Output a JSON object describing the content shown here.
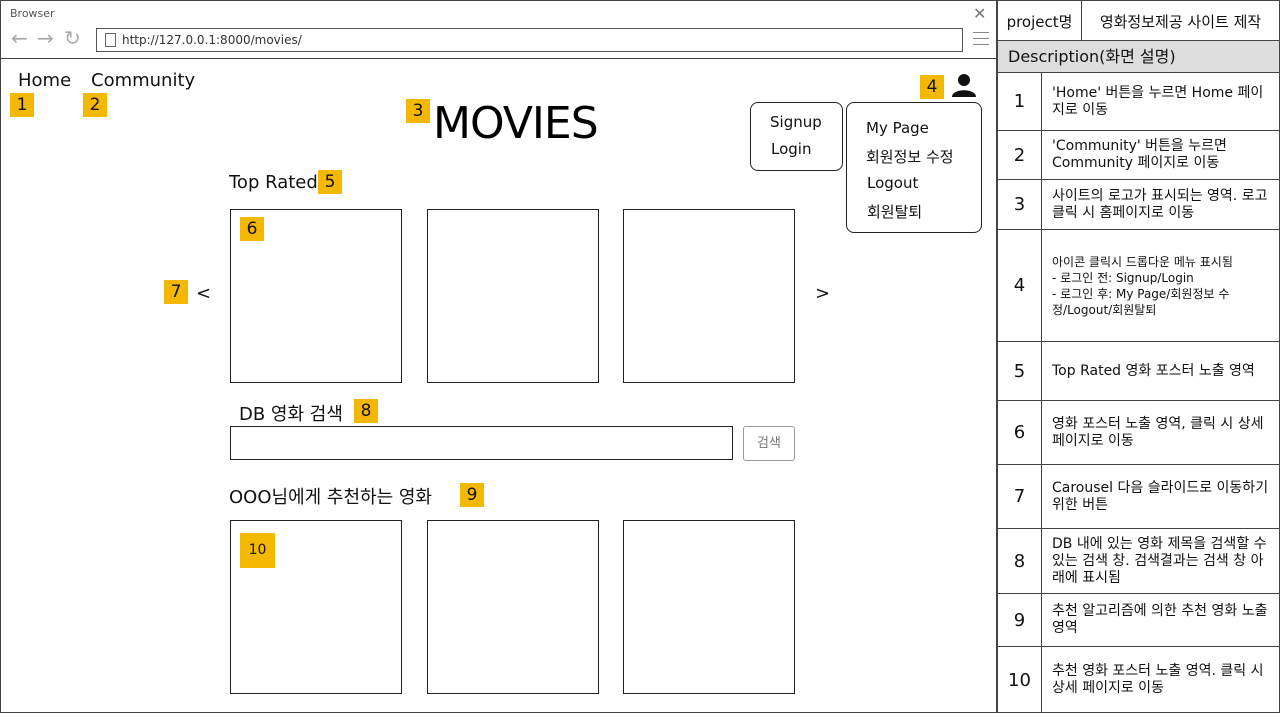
{
  "browser": {
    "title": "Browser",
    "url": "http://127.0.0.1:8000/movies/",
    "back_icon": "arrow-left-icon",
    "forward_icon": "arrow-right-icon",
    "reload_icon": "reload-icon",
    "menu_icon": "hamburger-menu-icon",
    "close_icon": "close-icon"
  },
  "nav": {
    "home": "Home",
    "community": "Community"
  },
  "logo": "MOVIES",
  "sections": {
    "top_rated": "Top Rated",
    "db_search": "DB 영화 검색",
    "recommend": "OOO님에게 추천하는 영화"
  },
  "search": {
    "button": "검색",
    "value": ""
  },
  "carousel": {
    "prev": "<",
    "next": ">"
  },
  "dropdown_logged_out": [
    "Signup",
    "Login"
  ],
  "dropdown_logged_in": [
    "My Page",
    "회원정보 수정",
    "Logout",
    "회원탈퇴"
  ],
  "tags": {
    "t1": "1",
    "t2": "2",
    "t3": "3",
    "t4": "4",
    "t5": "5",
    "t6": "6",
    "t7": "7",
    "t8": "8",
    "t9": "9",
    "t10": "10"
  },
  "accent_color": "#f5b800",
  "panel": {
    "project_key": "project명",
    "project_value": "영화정보제공 사이트 제작",
    "description_header": "Description(화면 설명)",
    "rows": [
      {
        "num": "1",
        "desc": "'Home' 버튼을 누르면 Home 페이지로 이동"
      },
      {
        "num": "2",
        "desc": "'Community' 버튼을 누르면 Community 페이지로 이동"
      },
      {
        "num": "3",
        "desc": "사이트의 로고가 표시되는 영역. 로고 클릭 시 홈페이지로 이동"
      },
      {
        "num": "4",
        "desc": "아이콘 클릭시 드롭다운 메뉴 표시됨\n- 로그인 전: Signup/Login\n- 로그인 후: My Page/회원정보 수정/Logout/회원탈퇴"
      },
      {
        "num": "5",
        "desc": "Top Rated 영화 포스터 노출 영역"
      },
      {
        "num": "6",
        "desc": "영화 포스터 노출 영역, 클릭 시 상세 페이지로 이동"
      },
      {
        "num": "7",
        "desc": "Carousel 다음 슬라이드로 이동하기 위한 버튼"
      },
      {
        "num": "8",
        "desc": "DB 내에 있는 영화 제목을 검색할 수 있는 검색 창. 검색결과는 검색 창 아래에 표시됨"
      },
      {
        "num": "9",
        "desc": "추천 알고리즘에 의한 추천 영화 노출 영역"
      },
      {
        "num": "10",
        "desc": "추천 영화 포스터 노출 영역. 클릭 시 상세 페이지로 이동"
      }
    ]
  }
}
